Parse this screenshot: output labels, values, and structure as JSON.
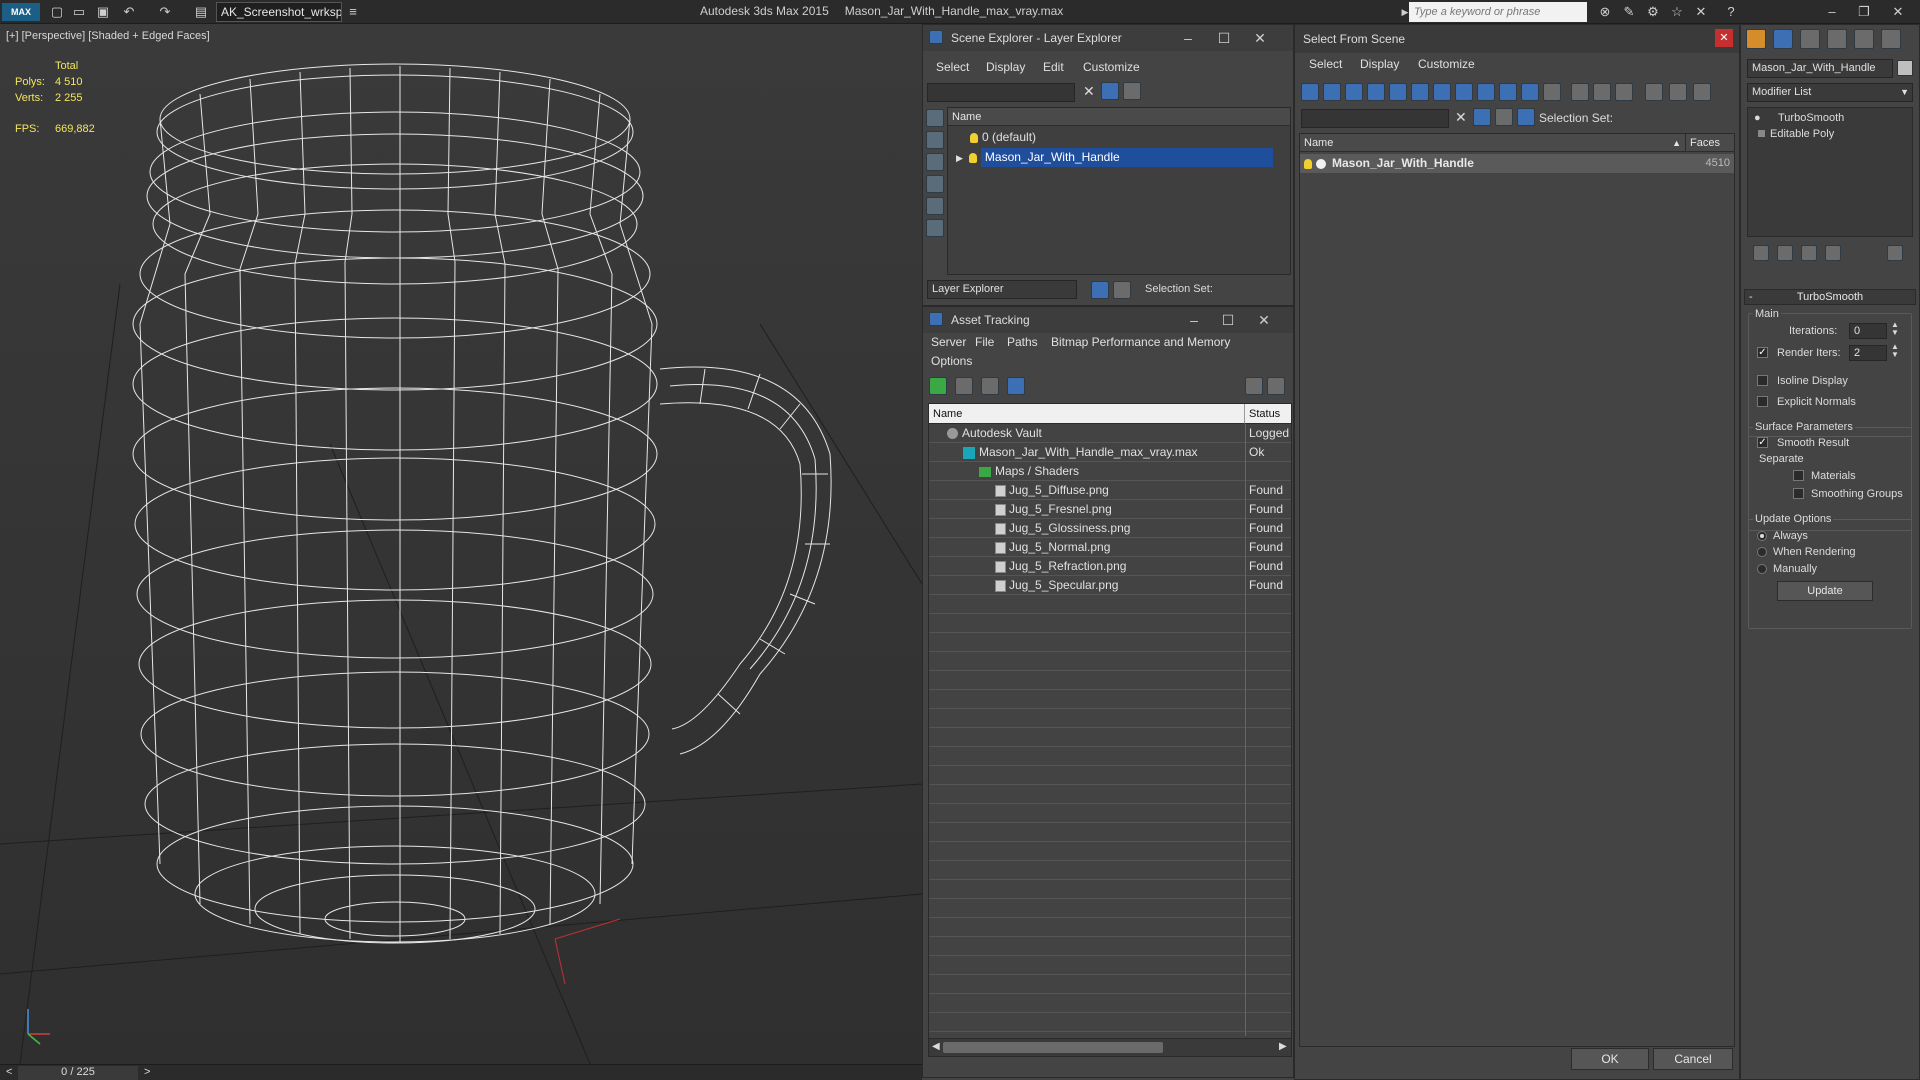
{
  "app": {
    "max_label": "MAX",
    "workspace": "AK_Screenshot_wrksp",
    "title": "Autodesk 3ds Max  2015",
    "file": "Mason_Jar_With_Handle_max_vray.max",
    "search_placeholder": "Type a keyword or phrase"
  },
  "viewport": {
    "label": "[+] [Perspective] [Shaded + Edged Faces]",
    "stats": {
      "total": "Total",
      "polys_label": "Polys:",
      "polys": "4 510",
      "verts_label": "Verts:",
      "verts": "2 255",
      "fps_label": "FPS:",
      "fps": "669,882"
    }
  },
  "timeline": {
    "frame": "0 / 225",
    "prev": "<",
    "next": ">"
  },
  "scene_explorer": {
    "title": "Scene Explorer - Layer Explorer",
    "menus": [
      "Select",
      "Display",
      "Edit",
      "Customize"
    ],
    "column": "Name",
    "rows": [
      {
        "name": "0 (default)"
      },
      {
        "name": "Mason_Jar_With_Handle"
      }
    ],
    "footer_dropdown": "Layer Explorer",
    "selection_set": "Selection Set:"
  },
  "asset_tracking": {
    "title": "Asset Tracking",
    "menus": [
      "Server",
      "File",
      "Paths",
      "Bitmap Performance and Memory",
      "Options"
    ],
    "columns": [
      "Name",
      "Status"
    ],
    "rows": [
      {
        "name": "Autodesk Vault",
        "status": "Logged",
        "indent": 0,
        "icon": "vault"
      },
      {
        "name": "Mason_Jar_With_Handle_max_vray.max",
        "status": "Ok",
        "indent": 1,
        "icon": "max"
      },
      {
        "name": "Maps / Shaders",
        "status": "",
        "indent": 2,
        "icon": "folder"
      },
      {
        "name": "Jug_5_Diffuse.png",
        "status": "Found",
        "indent": 3,
        "icon": "file"
      },
      {
        "name": "Jug_5_Fresnel.png",
        "status": "Found",
        "indent": 3,
        "icon": "file"
      },
      {
        "name": "Jug_5_Glossiness.png",
        "status": "Found",
        "indent": 3,
        "icon": "file"
      },
      {
        "name": "Jug_5_Normal.png",
        "status": "Found",
        "indent": 3,
        "icon": "file"
      },
      {
        "name": "Jug_5_Refraction.png",
        "status": "Found",
        "indent": 3,
        "icon": "file"
      },
      {
        "name": "Jug_5_Specular.png",
        "status": "Found",
        "indent": 3,
        "icon": "file"
      }
    ]
  },
  "select_from_scene": {
    "title": "Select From Scene",
    "menus": [
      "Select",
      "Display",
      "Customize"
    ],
    "selection_set": "Selection Set:",
    "columns": [
      "Name",
      "Faces"
    ],
    "rows": [
      {
        "name": "Mason_Jar_With_Handle",
        "faces": "4510"
      }
    ],
    "ok": "OK",
    "cancel": "Cancel"
  },
  "command_panel": {
    "object_name": "Mason_Jar_With_Handle",
    "modifier_list": "Modifier List",
    "stack": [
      "TurboSmooth",
      "Editable Poly"
    ],
    "rollout": "TurboSmooth",
    "main_label": "Main",
    "iterations_label": "Iterations:",
    "iterations": "0",
    "render_iters_label": "Render Iters:",
    "render_iters": "2",
    "isoline": "Isoline Display",
    "explicit_normals": "Explicit Normals",
    "surface_params": "Surface Parameters",
    "smooth_result": "Smooth Result",
    "separate": "Separate",
    "materials": "Materials",
    "smoothing_groups": "Smoothing Groups",
    "update_options": "Update Options",
    "always": "Always",
    "when_rendering": "When Rendering",
    "manually": "Manually",
    "update_button": "Update"
  },
  "colors": {
    "selection": "#1f4e9c",
    "close_red": "#c62f2f",
    "stat_yellow": "#f2e65c"
  }
}
